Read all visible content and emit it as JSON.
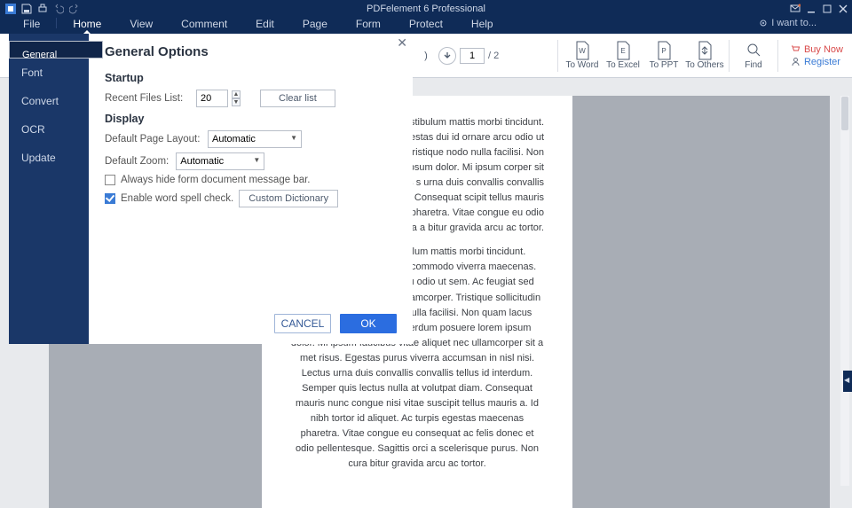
{
  "app": {
    "title": "PDFelement 6 Professional"
  },
  "menubar": {
    "items": [
      "File",
      "Home",
      "View",
      "Comment",
      "Edit",
      "Page",
      "Form",
      "Protect",
      "Help"
    ],
    "active_index": 1,
    "iwant": "I want to..."
  },
  "ribbon": {
    "nav": {
      "page_current": "1",
      "page_total": "/  2"
    },
    "convert": [
      {
        "label": "To Word",
        "letter": "W"
      },
      {
        "label": "To Excel",
        "letter": "E"
      },
      {
        "label": "To PPT",
        "letter": "P"
      },
      {
        "label": "To Others",
        "letter": "↕"
      }
    ],
    "find": "Find",
    "account": {
      "buy": "Buy Now",
      "register": "Register"
    }
  },
  "dialog": {
    "title": "General Options",
    "sidebar": [
      "General",
      "Font",
      "Convert",
      "OCR",
      "Update"
    ],
    "sidebar_sel": 0,
    "startup": {
      "heading": "Startup",
      "recent_label": "Recent Files List:",
      "recent_value": "20",
      "clear": "Clear list"
    },
    "display": {
      "heading": "Display",
      "layout_label": "Default Page Layout:",
      "layout_value": "Automatic",
      "zoom_label": "Default Zoom:",
      "zoom_value": "Automatic",
      "hide_msg": "Always hide form document message bar.",
      "hide_msg_on": false,
      "spell": "Enable word spell check.",
      "spell_on": true,
      "custom_dict": "Custom Dictionary"
    },
    "buttons": {
      "cancel": "CANCEL",
      "ok": "OK"
    }
  },
  "document": {
    "para1": "ntesque massa. Vestibulum mattis morbi tincidunt. Malesuada nunc vel s. Egestas dui id ornare arcu odio ut ulum mattis ullamcorper. Tristique nodo nulla facilisi. Non quam lacus osuere lorem ipsum dolor. Mi ipsum corper sit a met risus. Egestas purus s urna duis convallis convallis tellus nulla at volutpat diam. Consequat scipit tellus mauris a. Id nibh tortor id cenas pharetra. Vitae congue eu odio pellentesque. Sagittis orci a a bitur gravida arcu ac tortor.",
    "para2": "ntesque massa. Vestibulum mattis morbi tincidunt. Malesuada nunc vel risus commodo viverra maecenas. Egestas dui id ornare arcu odio ut sem. Ac feugiat sed lectus vestibulum mattis ullamcorper. Tristique sollicitudin nibh sit amet commodo nulla facilisi. Non quam lacus suspendisse faucibus interdum posuere lorem ipsum dolor. Mi ipsum faucibus vitae aliquet nec ullamcorper sit a met risus. Egestas purus viverra accumsan in nisl nisi. Lectus urna duis convallis convallis tellus id interdum. Semper quis lectus nulla at volutpat diam. Consequat mauris nunc congue nisi vitae suscipit tellus mauris a. Id nibh tortor id aliquet. Ac turpis egestas maecenas pharetra. Vitae congue eu consequat ac felis donec et odio pellentesque. Sagittis orci a scelerisque purus. Non cura bitur gravida arcu ac tortor."
  }
}
